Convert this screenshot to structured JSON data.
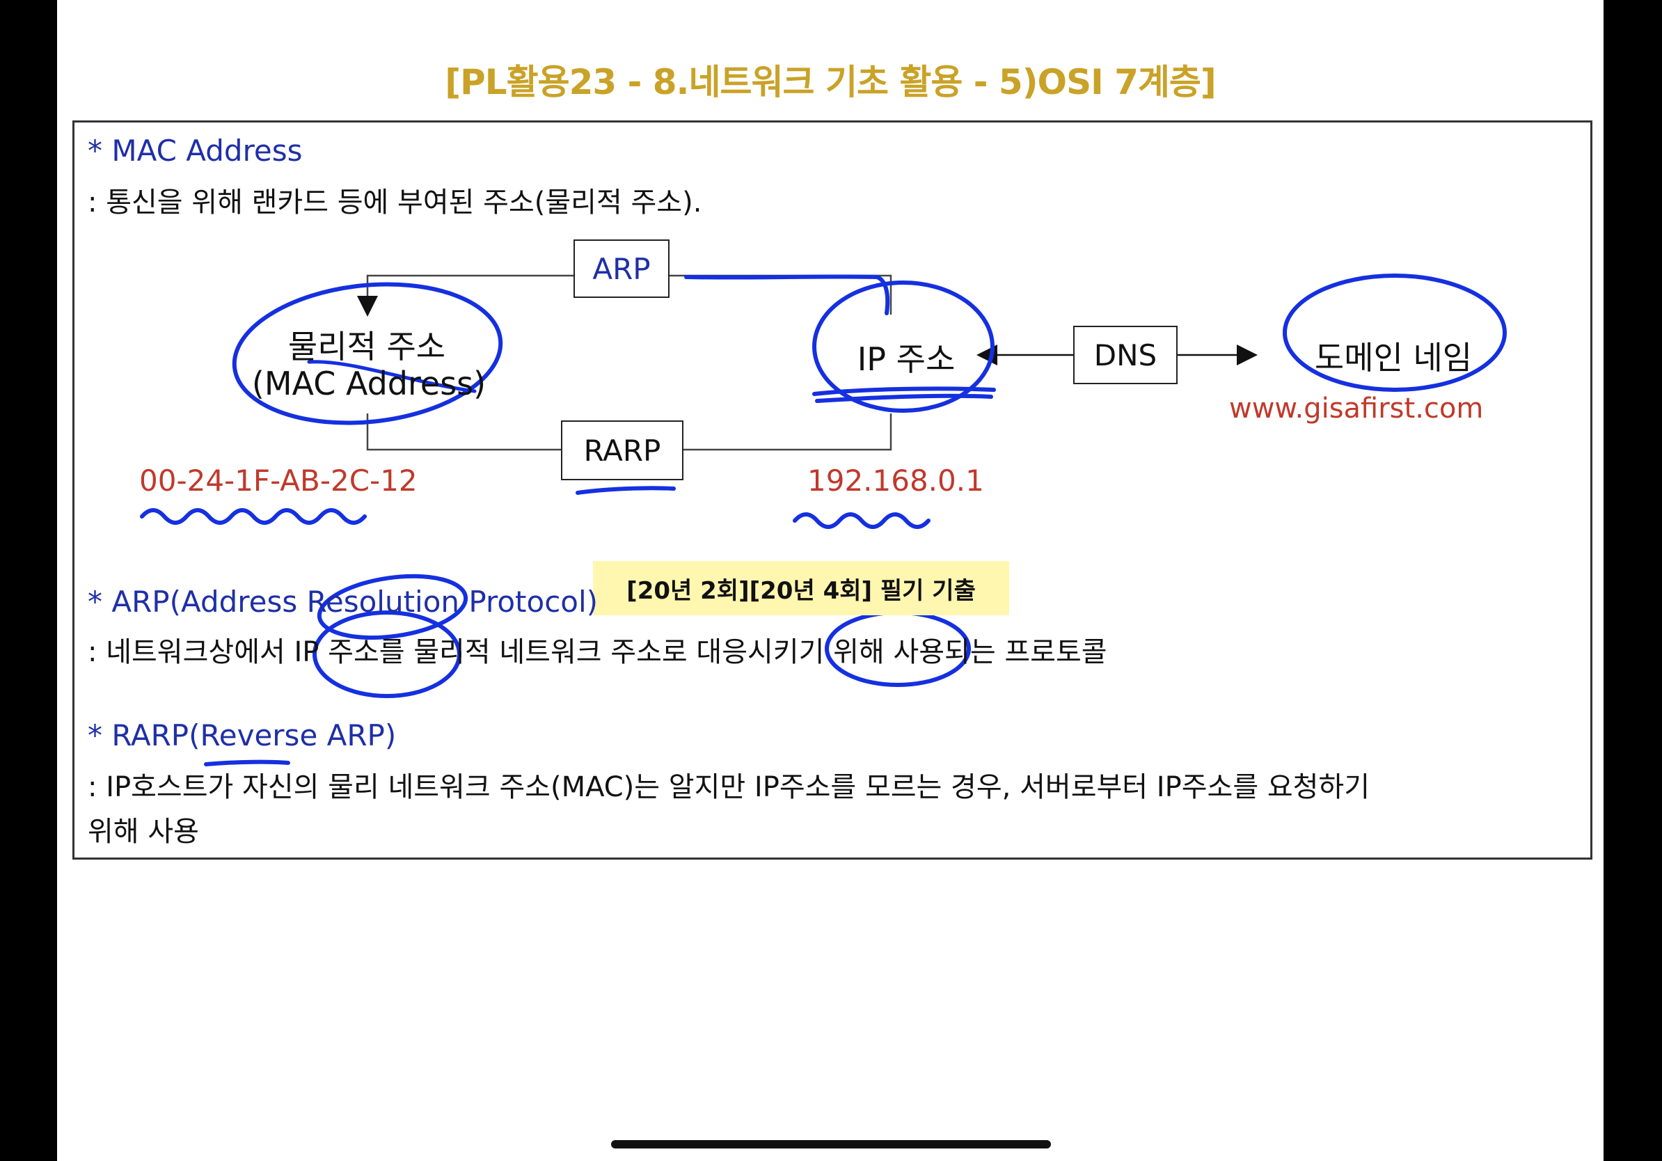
{
  "title": "[PL활용23 - 8.네트워크 기초 활용 - 5)OSI 7계층]",
  "mac": {
    "heading": "* MAC Address",
    "desc": ": 통신을 위해 랜카드 등에 부여된 주소(물리적 주소)."
  },
  "diagram": {
    "arp_label": "ARP",
    "rarp_label": "RARP",
    "dns_label": "DNS",
    "physical_line1": "물리적 주소",
    "physical_line2": "(MAC Address)",
    "ip_label": "IP 주소",
    "domain_label": "도메인 네임",
    "mac_example": "00-24-1F-AB-2C-12",
    "ip_example": "192.168.0.1",
    "domain_example": "www.gisafirst.com"
  },
  "badge": "[20년 2회][20년 4회] 필기 기출",
  "arp": {
    "heading": "* ARP(Address Resolution Protocol)",
    "desc": ": 네트워크상에서 IP 주소를 물리적 네트워크 주소로 대응시키기 위해 사용되는 프로토콜"
  },
  "rarp": {
    "heading": "* RARP(Reverse ARP)",
    "desc_line1": ": IP호스트가 자신의 물리 네트워크 주소(MAC)는 알지만 IP주소를 모르는 경우, 서버로부터 IP주소를 요청하기",
    "desc_line2": "위해 사용"
  },
  "colors": {
    "title": "#c9a227",
    "heading": "#1f2fa8",
    "example": "#c0392b",
    "annotation": "#1530e0",
    "badge_bg": "#fff6b0"
  }
}
